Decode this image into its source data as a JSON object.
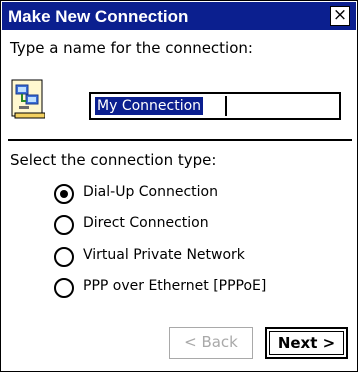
{
  "window": {
    "title": "Make New Connection",
    "close_glyph": "×"
  },
  "name_section": {
    "prompt": "Type a name for the connection:",
    "icon": "network-connection-icon",
    "input_value": "My Connection"
  },
  "type_section": {
    "prompt": "Select the connection type:",
    "options": [
      {
        "label": "Dial-Up Connection",
        "selected": true
      },
      {
        "label": "Direct Connection",
        "selected": false
      },
      {
        "label": "Virtual Private Network",
        "selected": false
      },
      {
        "label": "PPP over Ethernet [PPPoE]",
        "selected": false
      }
    ]
  },
  "buttons": {
    "back_label": "< Back",
    "next_label": "Next >",
    "back_enabled": false
  },
  "colors": {
    "titlebar": "#0b1f8f",
    "selection": "#0b1f8f",
    "disabled_text": "#a9a9a9"
  }
}
